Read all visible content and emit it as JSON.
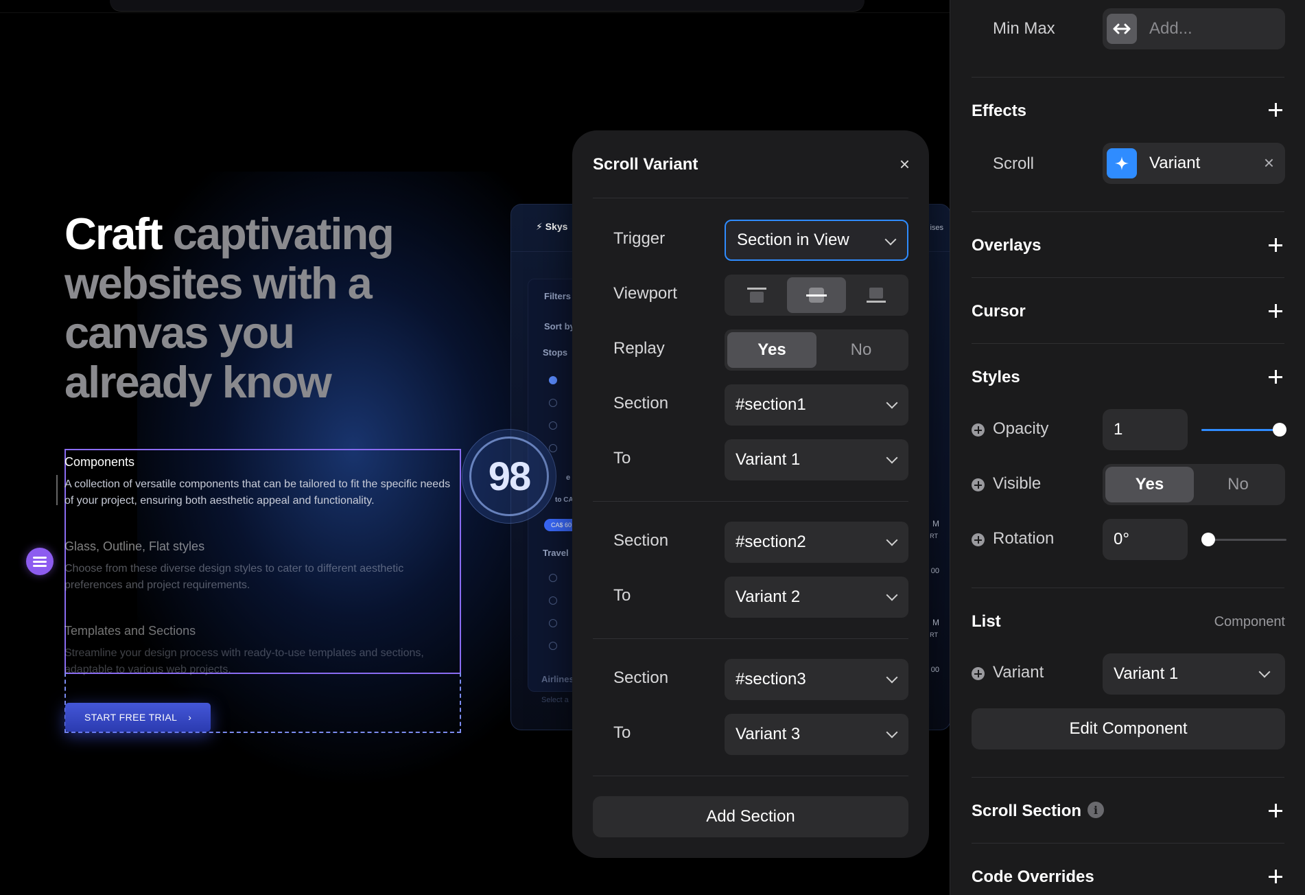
{
  "canvas": {
    "hero": {
      "part1": "Craft",
      "part2": " captivating websites with a canvas you already know"
    },
    "features": [
      {
        "title": "Components",
        "desc": "A collection of versatile components that can be tailored to fit the specific needs of your project, ensuring both aesthetic appeal and functionality.",
        "opacity": 1.0
      },
      {
        "title": "Glass, Outline, Flat styles",
        "desc": "Choose from these diverse design styles to cater to different aesthetic preferences and project requirements.",
        "opacity": 0.45
      },
      {
        "title": "Templates and Sections",
        "desc": "Streamline your design process with ready-to-use templates and sections, adaptable to various web projects.",
        "opacity": 0.35
      }
    ],
    "cta": {
      "label": "START FREE TRIAL",
      "chevron": "›"
    },
    "score": "98",
    "mockup": {
      "brand": "Skys",
      "edge": "ises",
      "labels": [
        "Filters",
        "Sort by",
        "Stops",
        "e",
        "to CA",
        "Travel",
        "Airlines",
        "Select a"
      ],
      "pill": "CA$ 60",
      "right_labels": [
        "M",
        "RT",
        "00",
        "M",
        "RT",
        "00"
      ]
    }
  },
  "dialog": {
    "title": "Scroll Variant",
    "close": "×",
    "trigger": {
      "label": "Trigger",
      "value": "Section in View"
    },
    "viewport": {
      "label": "Viewport",
      "options": [
        "top",
        "center",
        "bottom"
      ],
      "selected": "center"
    },
    "replay": {
      "label": "Replay",
      "yes": "Yes",
      "no": "No",
      "selected": "Yes"
    },
    "sections": [
      {
        "section_label": "Section",
        "section": "#section1",
        "to_label": "To",
        "to": "Variant 1"
      },
      {
        "section_label": "Section",
        "section": "#section2",
        "to_label": "To",
        "to": "Variant 2"
      },
      {
        "section_label": "Section",
        "section": "#section3",
        "to_label": "To",
        "to": "Variant 3"
      }
    ],
    "add_section": "Add Section"
  },
  "panel": {
    "minmax": {
      "label": "Min Max",
      "placeholder": "Add..."
    },
    "effects": {
      "title": "Effects",
      "scroll_label": "Scroll",
      "scroll_value": "Variant",
      "remove": "×"
    },
    "overlays": "Overlays",
    "cursor": "Cursor",
    "styles": {
      "title": "Styles",
      "opacity": {
        "label": "Opacity",
        "value": "1",
        "level": 1.0
      },
      "visible": {
        "label": "Visible",
        "yes": "Yes",
        "no": "No",
        "selected": "Yes"
      },
      "rotation": {
        "label": "Rotation",
        "value": "0°",
        "level": 0.0
      }
    },
    "list": {
      "title": "List",
      "tag": "Component",
      "variant_label": "Variant",
      "variant_value": "Variant 1",
      "edit_button": "Edit Component"
    },
    "scroll_section": {
      "title": "Scroll Section",
      "info": "i"
    },
    "code_overrides": "Code Overrides",
    "colors": {
      "accent": "#2f8cff",
      "selection": "#8a6cf2"
    }
  }
}
